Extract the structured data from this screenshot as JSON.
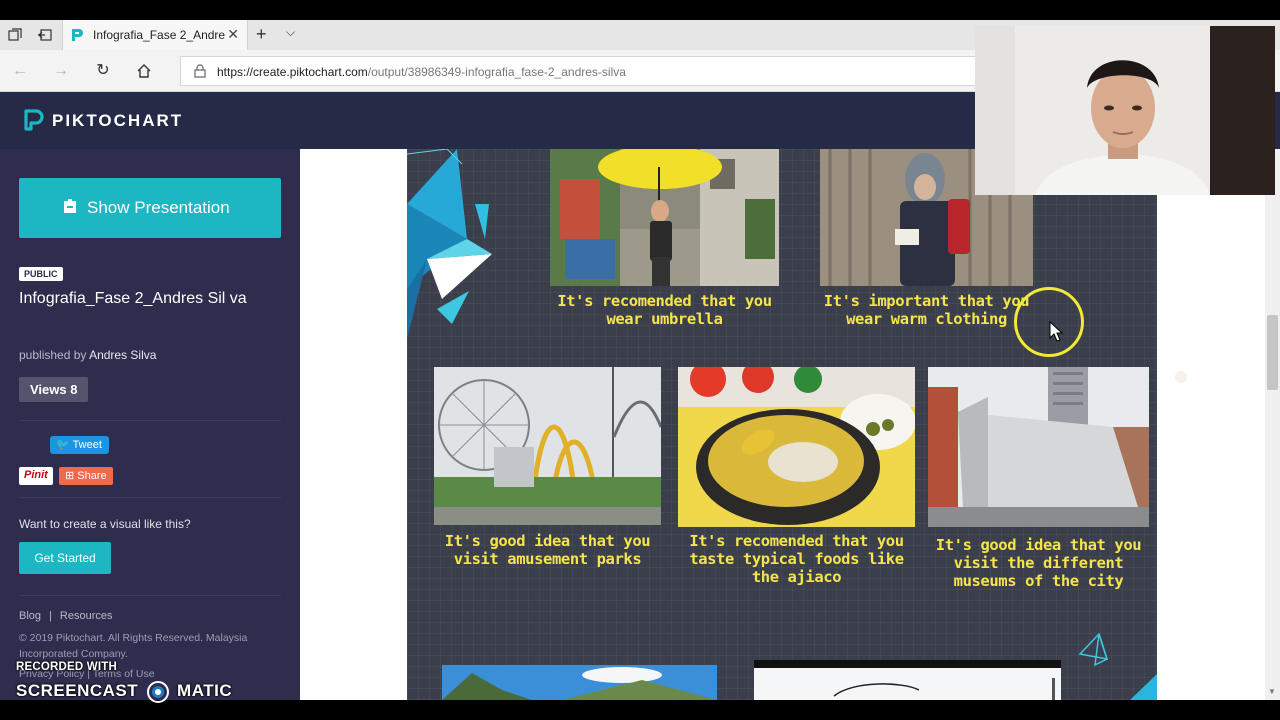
{
  "browser": {
    "tab_title": "Infografia_Fase 2_Andre",
    "url_host": "https://create.piktochart.com",
    "url_path": "/output/38986349-infografia_fase-2_andres-silva",
    "tab_actions_icon": "tab-actions-icon",
    "set_aside_icon": "set-aside-tabs-icon",
    "new_tab_icon": "plus-icon",
    "tab_list_icon": "chevron-down-icon",
    "back_icon": "arrow-left-icon",
    "forward_icon": "arrow-right-icon",
    "refresh_icon": "refresh-icon",
    "home_icon": "home-icon",
    "lock_icon": "lock-icon"
  },
  "header": {
    "brand": "PIKTOCHART",
    "brand_color": "#252a47"
  },
  "sidebar": {
    "show_presentation": "Show Presentation",
    "public_badge": "PUBLIC",
    "title": "Infografia_Fase 2_Andres Sil va",
    "published_by_label": "published by",
    "author": "Andres Silva",
    "views": "Views 8",
    "tweet": "Tweet",
    "pinit": "Pinit",
    "share": "Share",
    "cta_text": "Want to create a visual like this?",
    "get_started": "Get Started",
    "footer_links": [
      "Blog",
      "|",
      "Resources"
    ],
    "copyright": "© 2019 Piktochart. All Rights Reserved. Malaysia Incorporated Company.",
    "legal_links": "Privacy Policy | Terms of Use",
    "accent_color": "#1cb7c2",
    "background_color": "#2e2d4d"
  },
  "infographic": {
    "background_color": "#3a3f4b",
    "caption_color": "#f5e44a",
    "captions": [
      "It's recomended that you wear umbrella",
      "It's important that you wear warm clothing",
      "It's good idea that you visit amusement parks",
      "It's recomended that you taste typical foods like the ajiaco",
      "It's good idea that you visit the different museums of the city"
    ],
    "photos": [
      "umbrella-girl-photo",
      "warm-clothing-photo",
      "amusement-park-photo",
      "ajiaco-photo",
      "museum-building-photo",
      "mountain-photo",
      "sketch-photo"
    ]
  },
  "watermark": {
    "recorded_with": "RECORDED WITH",
    "brand_left": "SCREENCAST",
    "brand_right": "MATIC"
  }
}
